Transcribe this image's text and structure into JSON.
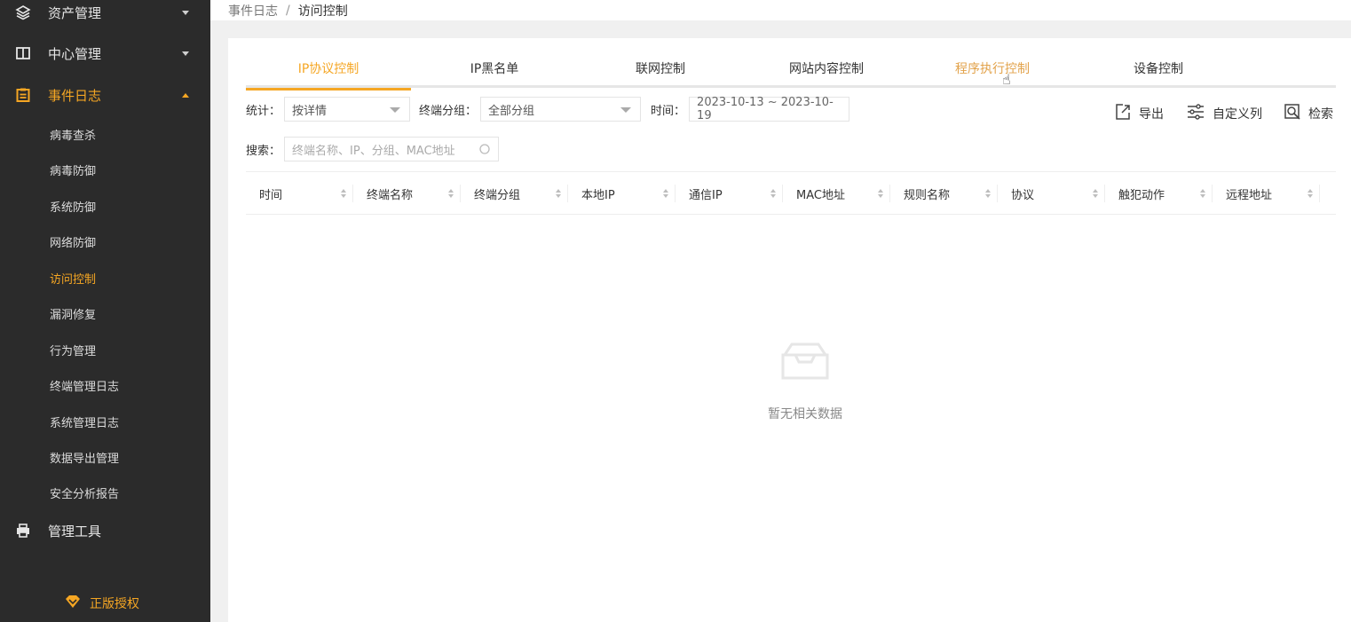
{
  "sidebar": {
    "menu": [
      {
        "label": "资产管理",
        "icon": "layers-icon"
      },
      {
        "label": "中心管理",
        "icon": "book-icon"
      },
      {
        "label": "事件日志",
        "icon": "clipboard-icon"
      },
      {
        "label": "管理工具",
        "icon": "printer-icon"
      }
    ],
    "sub_items": [
      "病毒查杀",
      "病毒防御",
      "系统防御",
      "网络防御",
      "访问控制",
      "漏洞修复",
      "行为管理",
      "终端管理日志",
      "系统管理日志",
      "数据导出管理",
      "安全分析报告"
    ],
    "active_sub": "访问控制",
    "license_label": "正版授权"
  },
  "breadcrumb": {
    "parent": "事件日志",
    "separator": "/",
    "current": "访问控制"
  },
  "tabs": [
    "IP协议控制",
    "IP黑名单",
    "联网控制",
    "网站内容控制",
    "程序执行控制",
    "设备控制"
  ],
  "filters": {
    "stat_label": "统计：",
    "stat_value": "按详情",
    "group_label": "终端分组：",
    "group_value": "全部分组",
    "time_label": "时间：",
    "time_value": "2023-10-13 ~ 2023-10-19",
    "search_label": "搜索：",
    "search_placeholder": "终端名称、IP、分组、MAC地址"
  },
  "toolbar": {
    "export_label": "导出",
    "columns_label": "自定义列",
    "search_label": "检索"
  },
  "table": {
    "columns": [
      "时间",
      "终端名称",
      "终端分组",
      "本地IP",
      "通信IP",
      "MAC地址",
      "规则名称",
      "协议",
      "触犯动作",
      "远程地址"
    ]
  },
  "empty_text": "暂无相关数据",
  "colors": {
    "accent": "#f5a623",
    "sidebar_bg": "#2b2b2b"
  }
}
